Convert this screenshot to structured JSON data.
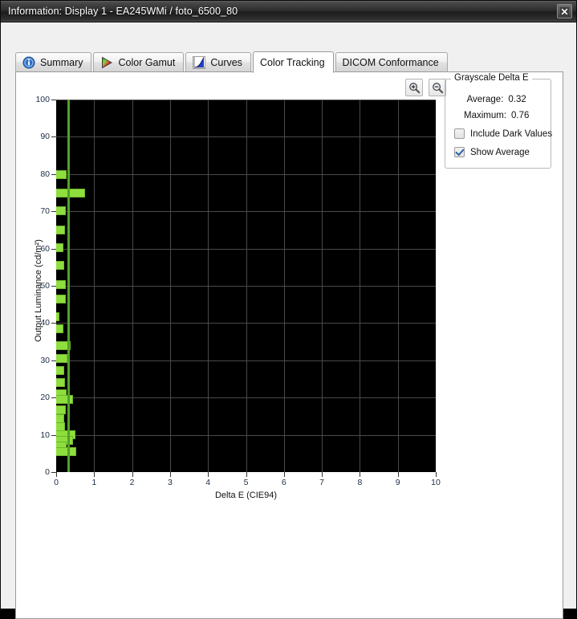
{
  "window": {
    "title": "Information: Display 1 - EA245WMi / foto_6500_80",
    "close_label": "Close",
    "close_icon": "close-icon"
  },
  "tabs": [
    {
      "id": "summary",
      "label": "Summary",
      "icon": "info-icon",
      "active": false
    },
    {
      "id": "gamut",
      "label": "Color Gamut",
      "icon": "color-triangle-icon",
      "active": false
    },
    {
      "id": "curves",
      "label": "Curves",
      "icon": "curve-chart-icon",
      "active": false
    },
    {
      "id": "tracking",
      "label": "Color Tracking",
      "icon": "",
      "active": true
    },
    {
      "id": "dicom",
      "label": "DICOM Conformance",
      "icon": "",
      "active": false
    }
  ],
  "toolbar": {
    "zoom_in": {
      "name": "zoom-in-button",
      "icon": "magnifier-plus-icon",
      "label": "+"
    },
    "zoom_out": {
      "name": "zoom-out-button",
      "icon": "magnifier-minus-icon",
      "label": "−"
    }
  },
  "grayscale_delta_e": {
    "legend": "Grayscale Delta E",
    "average_label": "Average:",
    "average_value": "0.32",
    "maximum_label": "Maximum:",
    "maximum_value": "0.76",
    "include_dark_values": {
      "label": "Include Dark Values",
      "checked": false
    },
    "show_average": {
      "label": "Show Average",
      "checked": true
    }
  },
  "colors": {
    "bar_fill": "#8ede3e",
    "bar_edge": "#6fb62b",
    "average_line": "#53a02a",
    "plot_background": "#000000",
    "gridline": "#4a4a4a",
    "axis_text": "#20304a"
  },
  "chart_data": {
    "type": "bar",
    "orientation": "horizontal",
    "title": "",
    "xlabel": "Delta E (CIE94)",
    "ylabel": "Output Luminance (cd/m²)",
    "xlim": [
      0,
      10
    ],
    "ylim": [
      0,
      100
    ],
    "xticks": [
      0,
      1,
      2,
      3,
      4,
      5,
      6,
      7,
      8,
      9,
      10
    ],
    "yticks": [
      0,
      10,
      20,
      30,
      40,
      50,
      60,
      70,
      80,
      90,
      100
    ],
    "grid": true,
    "legend": null,
    "average_line_value": 0.32,
    "maximum_value": 0.76,
    "series_name": "Grayscale Delta E",
    "categories": [
      79.8,
      74.9,
      70.2,
      65.0,
      60.3,
      55.4,
      50.4,
      46.5,
      41.6,
      38.4,
      34.0,
      30.5,
      27.3,
      24.0,
      21.0,
      19.4,
      16.7,
      14.4,
      12.2,
      10.0,
      8.5,
      7.0,
      5.6
    ],
    "values": [
      0.27,
      0.76,
      0.25,
      0.24,
      0.2,
      0.22,
      0.26,
      0.26,
      0.09,
      0.2,
      0.37,
      0.29,
      0.21,
      0.24,
      0.27,
      0.45,
      0.25,
      0.22,
      0.24,
      0.5,
      0.45,
      0.28,
      0.52
    ]
  }
}
